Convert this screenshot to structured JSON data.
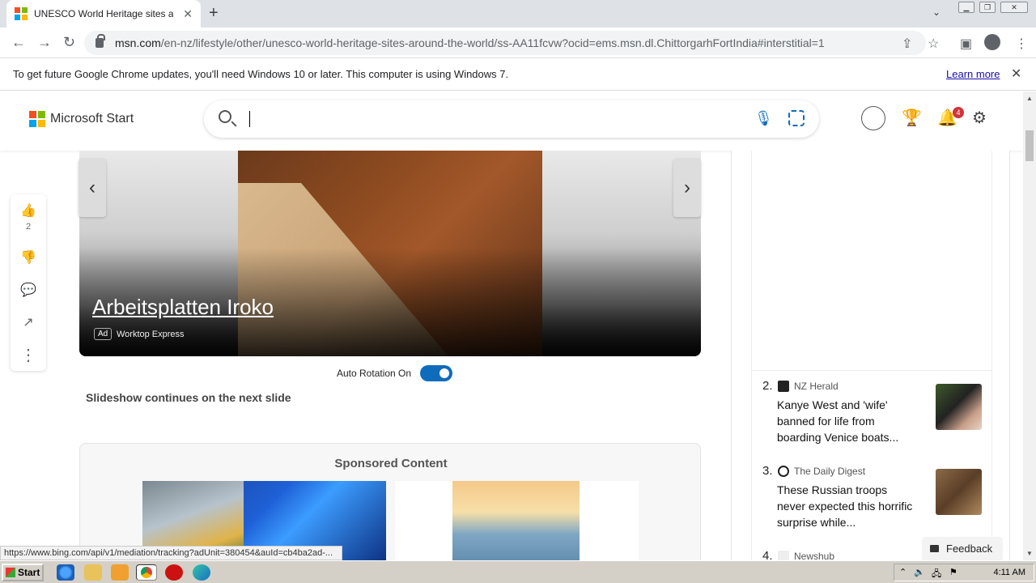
{
  "browser": {
    "tab_title": "UNESCO World Heritage sites around the world",
    "url_host": "msn.com",
    "url_path": "/en-nz/lifestyle/other/unesco-world-heritage-sites-around-the-world/ss-AA11fcvw?ocid=ems.msn.dl.ChittorgarhFortIndia#interstitial=1"
  },
  "infobar": {
    "message": "To get future Google Chrome updates, you'll need Windows 10 or later. This computer is using Windows 7.",
    "learn_more": "Learn more"
  },
  "msn": {
    "brand": "Microsoft Start",
    "notification_count": "4"
  },
  "rail": {
    "like_count": "2"
  },
  "slide": {
    "ad_title": "Arbeitsplatten Iroko",
    "ad_tag": "Ad",
    "ad_source": "Worktop Express",
    "auto_rotation_label": "Auto Rotation On",
    "auto_rotation_on": true,
    "continues_text": "Slideshow continues on the next slide"
  },
  "sponsored": {
    "header": "Sponsored Content"
  },
  "news": [
    {
      "num": "2.",
      "source": "NZ Herald",
      "headline": "Kanye West and 'wife' banned for life from boarding Venice boats..."
    },
    {
      "num": "3.",
      "source": "The Daily Digest",
      "headline": "These Russian troops never expected this horrific surprise while..."
    },
    {
      "num": "4.",
      "source": "Newshub",
      "headline": ""
    }
  ],
  "feedback_label": "Feedback",
  "status_url": "https://www.bing.com/api/v1/mediation/tracking?adUnit=380454&auId=cb4ba2ad-...",
  "taskbar": {
    "start_label": "Start",
    "clock": "4:11 AM"
  },
  "colors": {
    "accent": "#0f6cbd",
    "badge": "#d13438"
  }
}
